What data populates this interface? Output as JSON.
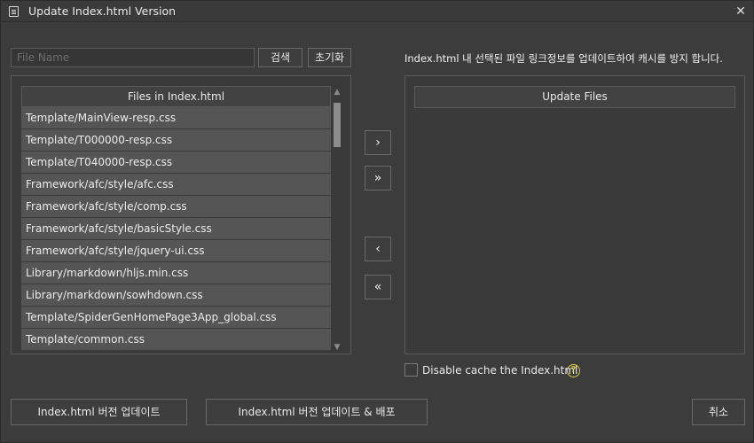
{
  "window": {
    "title": "Update Index.html Version",
    "icon": "document-list-icon",
    "close_glyph": "✕"
  },
  "search": {
    "placeholder": "File Name",
    "value": "",
    "search_label": "검색",
    "reset_label": "초기화"
  },
  "info_text": "Index.html 내 선택된 파일 링크정보를 업데이트하여 캐시를 방지 합니다.",
  "left_list": {
    "header": "Files in Index.html",
    "items": [
      "Template/MainView-resp.css",
      "Template/T000000-resp.css",
      "Template/T040000-resp.css",
      "Framework/afc/style/afc.css",
      "Framework/afc/style/comp.css",
      "Framework/afc/style/basicStyle.css",
      "Framework/afc/style/jquery-ui.css",
      "Library/markdown/hljs.min.css",
      "Library/markdown/sowhdown.css",
      "Template/SpiderGenHomePage3App_global.css",
      "Template/common.css"
    ]
  },
  "transfer": {
    "add_one": "›",
    "add_all": "»",
    "remove_one": "‹",
    "remove_all": "«"
  },
  "right_list": {
    "header": "Update Files",
    "items": []
  },
  "options": {
    "disable_cache_label": "Disable cache the Index.html",
    "disable_cache_checked": false,
    "help_glyph": "?"
  },
  "footer": {
    "update_label": "Index.html 버전 업데이트",
    "update_deploy_label": "Index.html 버전 업데이트 & 배포",
    "cancel_label": "취소"
  },
  "colors": {
    "background": "#3c3c3c",
    "list_item": "#555555",
    "help_accent": "#e2c93a"
  }
}
